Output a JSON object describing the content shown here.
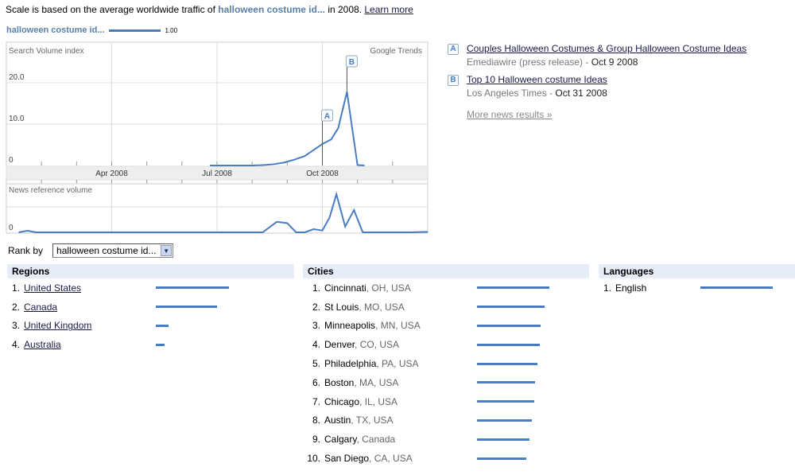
{
  "header": {
    "scale_prefix": "Scale is based on the average worldwide traffic of",
    "scale_term": "halloween costume id...",
    "scale_suffix": "in 2008.",
    "learn_more": "Learn more"
  },
  "legend": {
    "term": "halloween costume id...",
    "value": "1.00",
    "color": "#4a7cc4"
  },
  "chart_data": [
    {
      "type": "line",
      "title": "Search Volume index",
      "watermark": "Google Trends",
      "ylabel": "Search Volume index",
      "ylim": [
        0,
        25
      ],
      "yticks": [
        {
          "v": 0,
          "label": "0"
        },
        {
          "v": 10,
          "label": "10.0"
        },
        {
          "v": 20,
          "label": "20.0"
        }
      ],
      "xlim": [
        0,
        12
      ],
      "xticks_major": [
        {
          "m": 3,
          "label": "Apr 2008"
        },
        {
          "m": 6,
          "label": "Jul 2008"
        },
        {
          "m": 9,
          "label": "Oct 2008"
        }
      ],
      "xticks_minor": [
        1,
        2,
        4,
        5,
        7,
        8,
        10,
        11
      ],
      "series": [
        {
          "name": "halloween costume id...",
          "color": "#4a7cc4",
          "x": [
            5.8,
            6.2,
            6.5,
            6.8,
            7.0,
            7.3,
            7.6,
            7.9,
            8.2,
            8.5,
            9.0,
            9.25,
            9.45,
            9.7,
            10.0,
            10.2
          ],
          "values": [
            0,
            0,
            0,
            0,
            0,
            0.1,
            0.3,
            0.7,
            1.4,
            2.3,
            5.2,
            6.3,
            9.0,
            17.8,
            0.1,
            0
          ]
        }
      ],
      "annotations": [
        {
          "label": "A",
          "x": 9.0,
          "y": 5.2
        },
        {
          "label": "B",
          "x": 9.7,
          "y": 17.8
        }
      ]
    },
    {
      "type": "line",
      "title": "News reference volume",
      "ylabel": "News reference volume",
      "ylim": [
        0,
        2
      ],
      "yticks": [
        {
          "v": 0,
          "label": "0"
        }
      ],
      "xlim": [
        0,
        12
      ],
      "series": [
        {
          "name": "news",
          "color": "#4a7cc4",
          "x": [
            0.35,
            0.6,
            0.85,
            1.5,
            3,
            4.5,
            6,
            7.3,
            7.7,
            8.0,
            8.25,
            8.5,
            8.75,
            9.0,
            9.2,
            9.4,
            9.65,
            9.9,
            10.15,
            10.5,
            11.5,
            12
          ],
          "values": [
            0,
            0.06,
            0,
            0,
            0,
            0,
            0,
            0,
            0.4,
            0.35,
            0,
            0,
            0.12,
            0.07,
            0.55,
            1.45,
            0.22,
            0.85,
            0,
            0,
            0,
            0.02
          ]
        }
      ]
    }
  ],
  "news": [
    {
      "letter": "A",
      "title": "Couples Halloween Costumes & Group Halloween Costume Ideas",
      "source": "Emediawire (press release)",
      "date": "Oct 9 2008"
    },
    {
      "letter": "B",
      "title": "Top 10 Halloween costume Ideas",
      "source": "Los Angeles Times",
      "date": "Oct 31 2008"
    }
  ],
  "more_news": "More news results »",
  "rank_by": {
    "label": "Rank by",
    "selected": "halloween costume id..."
  },
  "regions": {
    "title": "Regions",
    "items": [
      {
        "n": "1.",
        "name": "United States",
        "value": 1.0
      },
      {
        "n": "2.",
        "name": "Canada",
        "value": 0.84
      },
      {
        "n": "3.",
        "name": "United Kingdom",
        "value": 0.17
      },
      {
        "n": "4.",
        "name": "Australia",
        "value": 0.12
      }
    ]
  },
  "cities": {
    "title": "Cities",
    "items": [
      {
        "n": "1.",
        "city": "Cincinnati",
        "rest": ", OH, USA",
        "value": 1.0
      },
      {
        "n": "2.",
        "city": "St Louis",
        "rest": ", MO, USA",
        "value": 0.93
      },
      {
        "n": "3.",
        "city": "Minneapolis",
        "rest": ", MN, USA",
        "value": 0.88
      },
      {
        "n": "4.",
        "city": "Denver",
        "rest": ", CO, USA",
        "value": 0.87
      },
      {
        "n": "5.",
        "city": "Philadelphia",
        "rest": ", PA, USA",
        "value": 0.84
      },
      {
        "n": "6.",
        "city": "Boston",
        "rest": ", MA, USA",
        "value": 0.8
      },
      {
        "n": "7.",
        "city": "Chicago",
        "rest": ", IL, USA",
        "value": 0.79
      },
      {
        "n": "8.",
        "city": "Austin",
        "rest": ", TX, USA",
        "value": 0.76
      },
      {
        "n": "9.",
        "city": "Calgary",
        "rest": ", Canada",
        "value": 0.72
      },
      {
        "n": "10.",
        "city": "San Diego",
        "rest": ", CA, USA",
        "value": 0.68
      }
    ]
  },
  "languages": {
    "title": "Languages",
    "items": [
      {
        "n": "1.",
        "name": "English",
        "value": 1.0
      }
    ]
  }
}
